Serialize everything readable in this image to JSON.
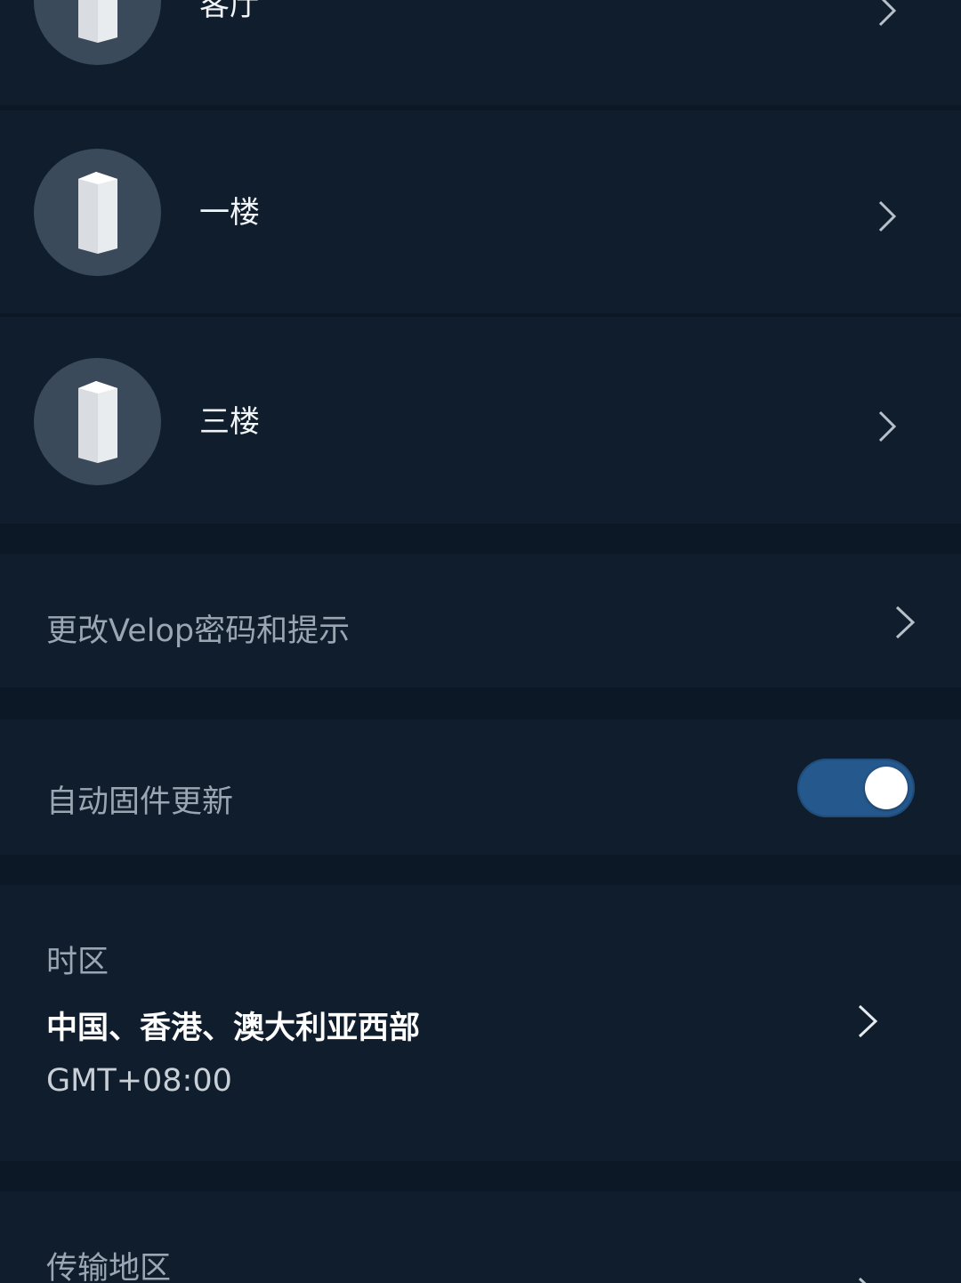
{
  "nodes": [
    {
      "name": "客厅"
    },
    {
      "name": "一楼"
    },
    {
      "name": "三楼"
    }
  ],
  "password": {
    "label": "更改Velop密码和提示"
  },
  "auto_update": {
    "label": "自动固件更新",
    "enabled": true
  },
  "timezone": {
    "title": "时区",
    "value": "中国、香港、澳大利亚西部",
    "offset": "GMT+08:00"
  },
  "transfer": {
    "label": "传输地区"
  },
  "icons": {
    "node": "velop-node-icon",
    "chevron": "chevron-right-icon"
  },
  "colors": {
    "background": "#0c1825",
    "card": "#101d2d",
    "toggle_on": "#25588c"
  }
}
